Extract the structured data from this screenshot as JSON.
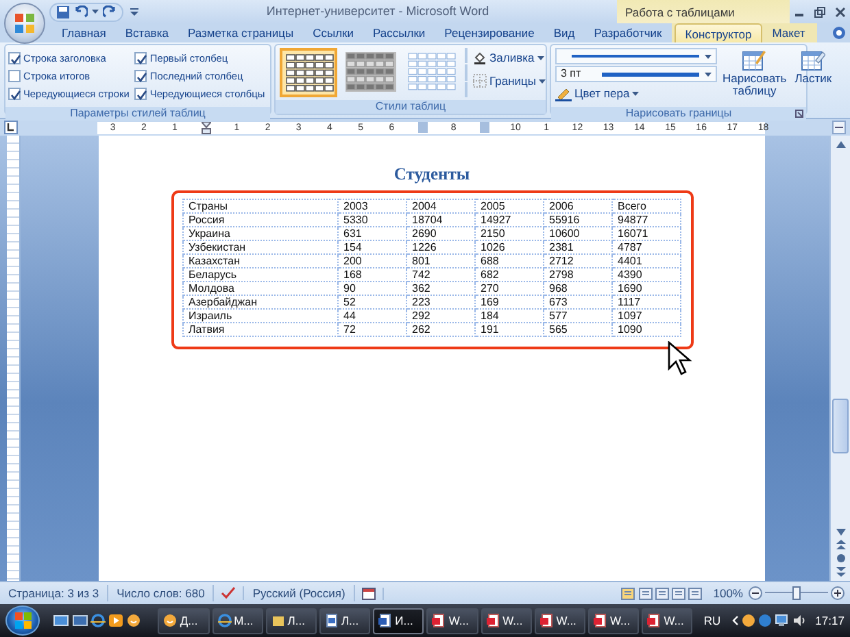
{
  "window": {
    "title": "Интернет-университет - Microsoft Word",
    "context_label": "Работа с таблицами"
  },
  "tabs": [
    {
      "label": "Главная",
      "selected": false
    },
    {
      "label": "Вставка",
      "selected": false
    },
    {
      "label": "Разметка страницы",
      "selected": false
    },
    {
      "label": "Ссылки",
      "selected": false
    },
    {
      "label": "Рассылки",
      "selected": false
    },
    {
      "label": "Рецензирование",
      "selected": false
    },
    {
      "label": "Вид",
      "selected": false
    },
    {
      "label": "Разработчик",
      "selected": false
    },
    {
      "label": "Конструктор",
      "selected": true,
      "kind": "context"
    },
    {
      "label": "Макет",
      "selected": false,
      "kind": "context"
    }
  ],
  "style_options": {
    "label": "Параметры стилей таблиц",
    "checkboxes": [
      {
        "label": "Строка заголовка",
        "checked": true
      },
      {
        "label": "Строка итогов",
        "checked": false
      },
      {
        "label": "Чередующиеся строки",
        "checked": true
      },
      {
        "label": "Первый столбец",
        "checked": true
      },
      {
        "label": "Последний столбец",
        "checked": true
      },
      {
        "label": "Чередующиеся столбцы",
        "checked": true
      }
    ]
  },
  "table_styles": {
    "label": "Стили таблиц",
    "styles": [
      {
        "kind": "plain",
        "selected": true
      },
      {
        "kind": "shaded",
        "selected": false
      },
      {
        "kind": "light",
        "selected": false
      }
    ],
    "fill": "Заливка",
    "borders": "Границы"
  },
  "draw_borders": {
    "label": "Нарисовать границы",
    "line_weight": "3 пт",
    "pen_color": "Цвет пера",
    "draw_table": "Нарисовать таблицу",
    "eraser": "Ластик"
  },
  "ruler": [
    {
      "kind": "number",
      "label": "3"
    },
    {
      "kind": "number",
      "label": "2"
    },
    {
      "kind": "number",
      "label": "1"
    },
    {
      "kind": "indent"
    },
    {
      "kind": "number",
      "label": "1"
    },
    {
      "kind": "number",
      "label": "2"
    },
    {
      "kind": "number",
      "label": "3"
    },
    {
      "kind": "number",
      "label": "4"
    },
    {
      "kind": "number",
      "label": "5"
    },
    {
      "kind": "number",
      "label": "6"
    },
    {
      "kind": "marker"
    },
    {
      "kind": "number",
      "label": "8"
    },
    {
      "kind": "marker"
    },
    {
      "kind": "number",
      "label": "10"
    },
    {
      "kind": "number",
      "label": "1"
    },
    {
      "kind": "number",
      "label": "12"
    },
    {
      "kind": "number",
      "label": "13"
    },
    {
      "kind": "number",
      "label": "14"
    },
    {
      "kind": "number",
      "label": "15"
    },
    {
      "kind": "number",
      "label": "16"
    },
    {
      "kind": "number",
      "label": "17"
    },
    {
      "kind": "number",
      "label": "18"
    }
  ],
  "document": {
    "title": "Студенты",
    "table": {
      "rows": [
        [
          "Страны",
          "2003",
          "2004",
          "2005",
          "2006",
          "Всего"
        ],
        [
          "Россия",
          "5330",
          "18704",
          "14927",
          "55916",
          "94877"
        ],
        [
          "Украина",
          "631",
          "2690",
          "2150",
          "10600",
          "16071"
        ],
        [
          "Узбекистан",
          "154",
          "1226",
          "1026",
          "2381",
          "4787"
        ],
        [
          "Казахстан",
          "200",
          "801",
          "688",
          "2712",
          "4401"
        ],
        [
          "Беларусь",
          "168",
          "742",
          "682",
          "2798",
          "4390"
        ],
        [
          "Молдова",
          "90",
          "362",
          "270",
          "968",
          "1690"
        ],
        [
          "Азербайджан",
          "52",
          "223",
          "169",
          "673",
          "1117"
        ],
        [
          "Израиль",
          "44",
          "292",
          "184",
          "577",
          "1097"
        ],
        [
          "Латвия",
          "72",
          "262",
          "191",
          "565",
          "1090"
        ]
      ]
    }
  },
  "status_bar": {
    "page": "Страница: 3 из 3",
    "words": "Число слов: 680",
    "language": "Русский (Россия)",
    "zoom": "100%",
    "zoom_slider": {
      "level": 0.5
    }
  },
  "taskbar": {
    "buttons": [
      {
        "kind": "messenger",
        "label": "Д...",
        "active": false
      },
      {
        "kind": "browser",
        "label": "M...",
        "active": false
      },
      {
        "kind": "folder",
        "label": "Л...",
        "active": false
      },
      {
        "kind": "document",
        "label": "Л...",
        "active": false
      },
      {
        "kind": "word",
        "label": "И...",
        "active": true
      },
      {
        "kind": "word-red",
        "label": "W...",
        "active": false
      },
      {
        "kind": "word-red",
        "label": "W...",
        "active": false
      },
      {
        "kind": "word-red",
        "label": "W...",
        "active": false
      },
      {
        "kind": "word-red",
        "label": "W...",
        "active": false
      },
      {
        "kind": "word-red",
        "label": "W...",
        "active": false
      }
    ],
    "language": "RU",
    "clock": "17:17"
  }
}
